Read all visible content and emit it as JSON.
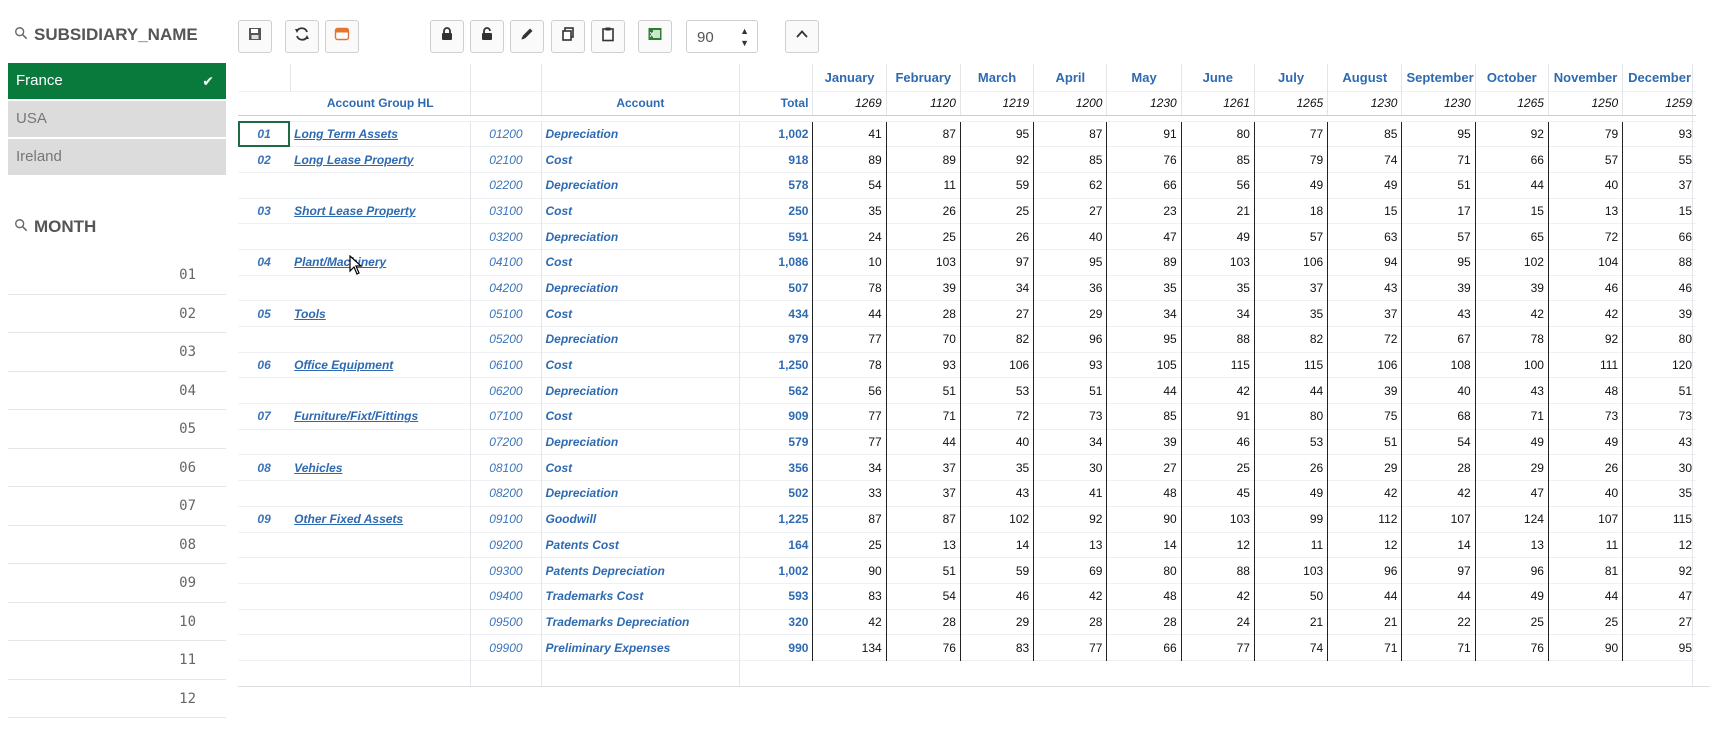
{
  "subsidiary_filter": {
    "title": "SUBSIDIARY_NAME",
    "items": [
      {
        "label": "France",
        "state": "selected"
      },
      {
        "label": "USA",
        "state": "alternative"
      },
      {
        "label": "Ireland",
        "state": "alternative"
      }
    ]
  },
  "month_filter": {
    "title": "MONTH",
    "items": [
      "01",
      "02",
      "03",
      "04",
      "05",
      "06",
      "07",
      "08",
      "09",
      "10",
      "11",
      "12"
    ]
  },
  "toolbar": {
    "buttons": [
      "save-icon",
      "refresh-icon",
      "window-icon",
      "lock-icon",
      "unlock-icon",
      "edit-icon",
      "copy-icon",
      "paste-icon",
      "excel-icon",
      "collapse-up-icon"
    ],
    "number_value": "90"
  },
  "table": {
    "headers": {
      "account_group": "Account Group HL",
      "account": "Account",
      "total": "Total"
    },
    "months": [
      "January",
      "February",
      "March",
      "April",
      "May",
      "June",
      "July",
      "August",
      "September",
      "October",
      "November",
      "December"
    ],
    "month_totals": [
      "1269",
      "1120",
      "1219",
      "1200",
      "1230",
      "1261",
      "1265",
      "1230",
      "1230",
      "1265",
      "1250",
      "1259"
    ],
    "rows": [
      {
        "grp": "01",
        "grp_name": "Long Term Assets",
        "acc": "01200",
        "desc": "Depreciation",
        "total": "1,002",
        "vals": [
          "41",
          "87",
          "95",
          "87",
          "91",
          "80",
          "77",
          "85",
          "95",
          "92",
          "79",
          "93"
        ]
      },
      {
        "grp": "02",
        "grp_name": "Long Lease Property",
        "acc": "02100",
        "desc": "Cost",
        "total": "918",
        "vals": [
          "89",
          "89",
          "92",
          "85",
          "76",
          "85",
          "79",
          "74",
          "71",
          "66",
          "57",
          "55"
        ]
      },
      {
        "grp": "",
        "grp_name": "",
        "acc": "02200",
        "desc": "Depreciation",
        "total": "578",
        "vals": [
          "54",
          "11",
          "59",
          "62",
          "66",
          "56",
          "49",
          "49",
          "51",
          "44",
          "40",
          "37"
        ]
      },
      {
        "grp": "03",
        "grp_name": "Short Lease Property",
        "acc": "03100",
        "desc": "Cost",
        "total": "250",
        "vals": [
          "35",
          "26",
          "25",
          "27",
          "23",
          "21",
          "18",
          "15",
          "17",
          "15",
          "13",
          "15"
        ]
      },
      {
        "grp": "",
        "grp_name": "",
        "acc": "03200",
        "desc": "Depreciation",
        "total": "591",
        "vals": [
          "24",
          "25",
          "26",
          "40",
          "47",
          "49",
          "57",
          "63",
          "57",
          "65",
          "72",
          "66"
        ]
      },
      {
        "grp": "04",
        "grp_name": "Plant/Machinery",
        "acc": "04100",
        "desc": "Cost",
        "total": "1,086",
        "vals": [
          "10",
          "103",
          "97",
          "95",
          "89",
          "103",
          "106",
          "94",
          "95",
          "102",
          "104",
          "88"
        ]
      },
      {
        "grp": "",
        "grp_name": "",
        "acc": "04200",
        "desc": "Depreciation",
        "total": "507",
        "vals": [
          "78",
          "39",
          "34",
          "36",
          "35",
          "35",
          "37",
          "43",
          "39",
          "39",
          "46",
          "46"
        ]
      },
      {
        "grp": "05",
        "grp_name": "Tools",
        "acc": "05100",
        "desc": "Cost",
        "total": "434",
        "vals": [
          "44",
          "28",
          "27",
          "29",
          "34",
          "34",
          "35",
          "37",
          "43",
          "42",
          "42",
          "39"
        ]
      },
      {
        "grp": "",
        "grp_name": "",
        "acc": "05200",
        "desc": "Depreciation",
        "total": "979",
        "vals": [
          "77",
          "70",
          "82",
          "96",
          "95",
          "88",
          "82",
          "72",
          "67",
          "78",
          "92",
          "80"
        ]
      },
      {
        "grp": "06",
        "grp_name": "Office Equipment",
        "acc": "06100",
        "desc": "Cost",
        "total": "1,250",
        "vals": [
          "78",
          "93",
          "106",
          "93",
          "105",
          "115",
          "115",
          "106",
          "108",
          "100",
          "111",
          "120"
        ]
      },
      {
        "grp": "",
        "grp_name": "",
        "acc": "06200",
        "desc": "Depreciation",
        "total": "562",
        "vals": [
          "56",
          "51",
          "53",
          "51",
          "44",
          "42",
          "44",
          "39",
          "40",
          "43",
          "48",
          "51"
        ]
      },
      {
        "grp": "07",
        "grp_name": "Furniture/Fixt/Fittings",
        "acc": "07100",
        "desc": "Cost",
        "total": "909",
        "vals": [
          "77",
          "71",
          "72",
          "73",
          "85",
          "91",
          "80",
          "75",
          "68",
          "71",
          "73",
          "73"
        ]
      },
      {
        "grp": "",
        "grp_name": "",
        "acc": "07200",
        "desc": "Depreciation",
        "total": "579",
        "vals": [
          "77",
          "44",
          "40",
          "34",
          "39",
          "46",
          "53",
          "51",
          "54",
          "49",
          "49",
          "43"
        ]
      },
      {
        "grp": "08",
        "grp_name": "Vehicles",
        "acc": "08100",
        "desc": "Cost",
        "total": "356",
        "vals": [
          "34",
          "37",
          "35",
          "30",
          "27",
          "25",
          "26",
          "29",
          "28",
          "29",
          "26",
          "30"
        ]
      },
      {
        "grp": "",
        "grp_name": "",
        "acc": "08200",
        "desc": "Depreciation",
        "total": "502",
        "vals": [
          "33",
          "37",
          "43",
          "41",
          "48",
          "45",
          "49",
          "42",
          "42",
          "47",
          "40",
          "35"
        ]
      },
      {
        "grp": "09",
        "grp_name": "Other Fixed Assets",
        "acc": "09100",
        "desc": "Goodwill",
        "total": "1,225",
        "vals": [
          "87",
          "87",
          "102",
          "92",
          "90",
          "103",
          "99",
          "112",
          "107",
          "124",
          "107",
          "115"
        ]
      },
      {
        "grp": "",
        "grp_name": "",
        "acc": "09200",
        "desc": "Patents Cost",
        "total": "164",
        "vals": [
          "25",
          "13",
          "14",
          "13",
          "14",
          "12",
          "11",
          "12",
          "14",
          "13",
          "11",
          "12"
        ]
      },
      {
        "grp": "",
        "grp_name": "",
        "acc": "09300",
        "desc": "Patents Depreciation",
        "total": "1,002",
        "vals": [
          "90",
          "51",
          "59",
          "69",
          "80",
          "88",
          "103",
          "96",
          "97",
          "96",
          "81",
          "92"
        ]
      },
      {
        "grp": "",
        "grp_name": "",
        "acc": "09400",
        "desc": "Trademarks Cost",
        "total": "593",
        "vals": [
          "83",
          "54",
          "46",
          "42",
          "48",
          "42",
          "50",
          "44",
          "44",
          "49",
          "44",
          "47"
        ]
      },
      {
        "grp": "",
        "grp_name": "",
        "acc": "09500",
        "desc": "Trademarks Depreciation",
        "total": "320",
        "vals": [
          "42",
          "28",
          "29",
          "28",
          "28",
          "24",
          "21",
          "21",
          "22",
          "25",
          "25",
          "27"
        ]
      },
      {
        "grp": "",
        "grp_name": "",
        "acc": "09900",
        "desc": "Preliminary Expenses",
        "total": "990",
        "vals": [
          "134",
          "76",
          "83",
          "77",
          "66",
          "77",
          "74",
          "71",
          "71",
          "76",
          "90",
          "95"
        ]
      }
    ]
  }
}
